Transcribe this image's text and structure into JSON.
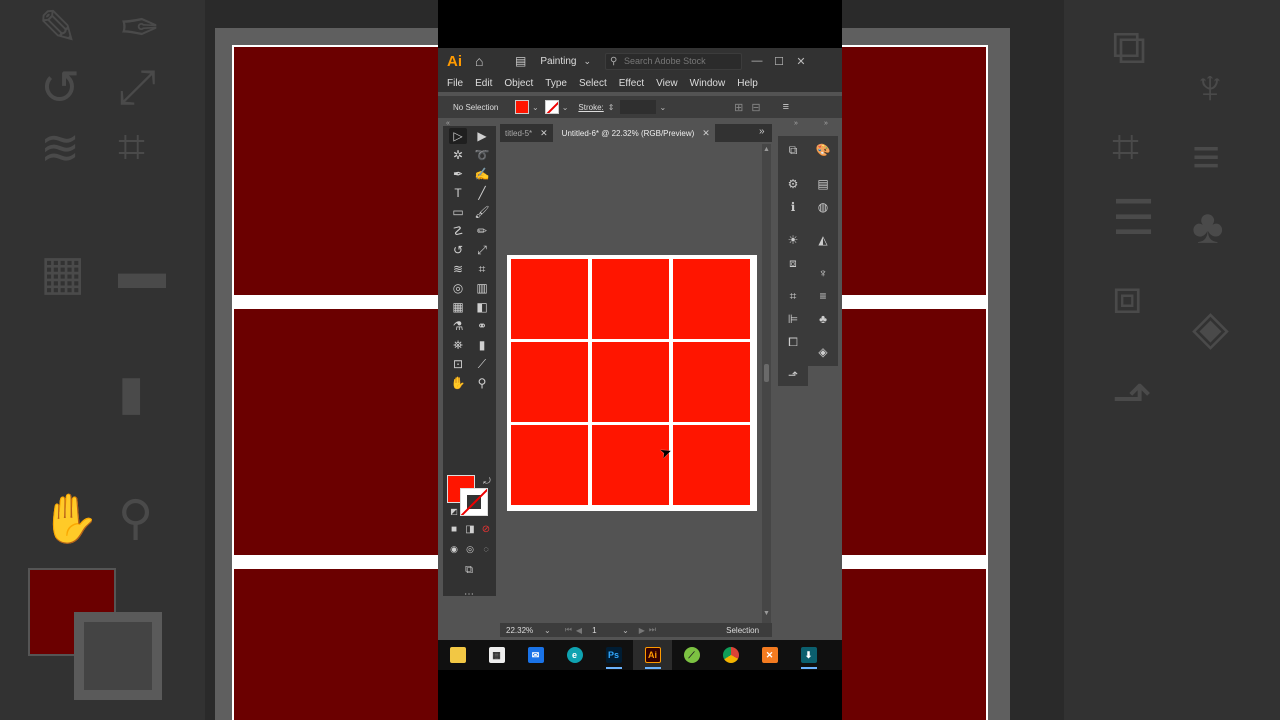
{
  "app": {
    "logo": "Ai",
    "workspace": "Painting",
    "search_placeholder": "Search Adobe Stock",
    "win_min": "—",
    "win_max": "☐",
    "win_close": "✕"
  },
  "menu": [
    "File",
    "Edit",
    "Object",
    "Type",
    "Select",
    "Effect",
    "View",
    "Window",
    "Help"
  ],
  "control": {
    "selection": "No Selection",
    "stroke_label": "Stroke:",
    "fill_color": "#ff1500"
  },
  "tabs": [
    {
      "label": "titled-5*",
      "active": false
    },
    {
      "label": "Untitled-6* @ 22.32% (RGB/Preview)",
      "active": true
    }
  ],
  "status": {
    "zoom": "22.32%",
    "artboard": "1",
    "tool": "Selection"
  },
  "artboard": {
    "rows": 3,
    "cols": 3,
    "cell_color": "#ff1500"
  },
  "toolbox_icons": [
    "selection-tool-icon",
    "direct-selection-tool-icon",
    "magic-wand-icon",
    "lasso-icon",
    "pen-icon",
    "curvature-icon",
    "type-icon",
    "line-segment-icon",
    "rectangle-icon",
    "paintbrush-icon",
    "shaper-icon",
    "pencil-icon",
    "rotate-icon",
    "scale-icon",
    "warp-icon",
    "free-transform-icon",
    "shape-builder-icon",
    "perspective-grid-icon",
    "mesh-icon",
    "gradient-icon",
    "eyedropper-icon",
    "blend-icon",
    "symbol-sprayer-icon",
    "column-graph-icon",
    "artboard-icon",
    "slice-icon",
    "hand-icon",
    "zoom-icon"
  ],
  "taskbar": [
    "file-explorer",
    "microsoft-store",
    "mail",
    "edge",
    "photoshop",
    "illustrator",
    "app-green",
    "chrome",
    "app-orange",
    "app-teal"
  ],
  "taskbar_labels": {
    "photoshop": "Ps",
    "illustrator": "Ai"
  }
}
